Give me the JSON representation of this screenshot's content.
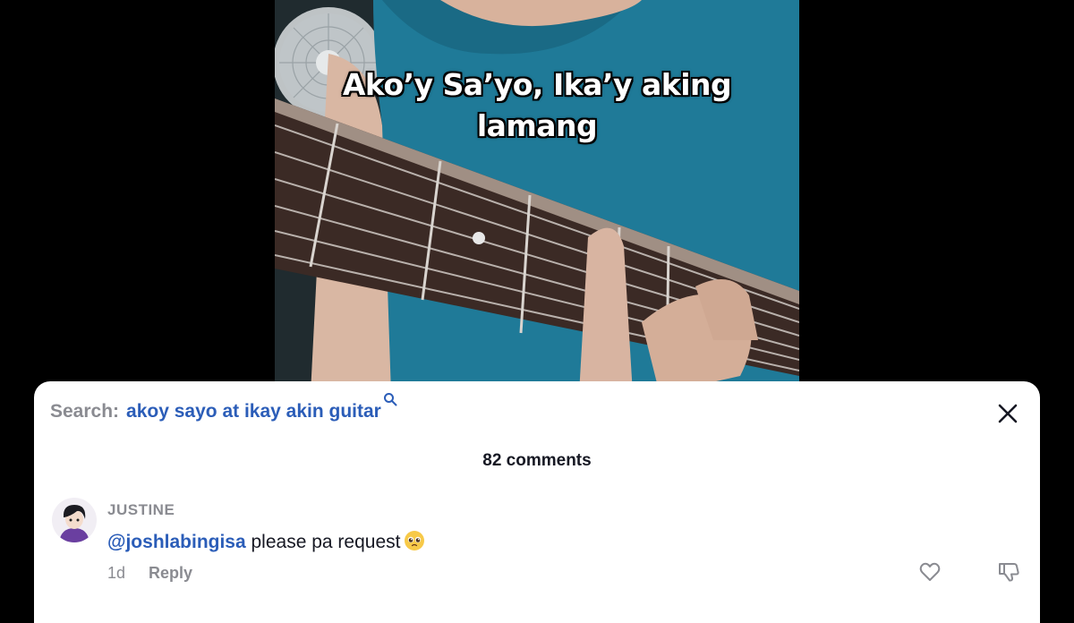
{
  "video": {
    "caption_line1": "Ako’y Sa’yo, Ika’y aking",
    "caption_line2": "lamang"
  },
  "sheet": {
    "search_prefix": "Search:",
    "search_query": "akoy sayo at ikay akin guitar",
    "comment_count": "82 comments"
  },
  "comment": {
    "author": "JUSTINE",
    "mention": "@joshlabingisa",
    "text": " please pa request",
    "emoji": "pleading-face",
    "age": "1d",
    "reply_label": "Reply"
  },
  "colors": {
    "link_blue": "#2b5db8",
    "muted_gray": "#8a8b91",
    "shirt_teal": "#1f7a98"
  }
}
